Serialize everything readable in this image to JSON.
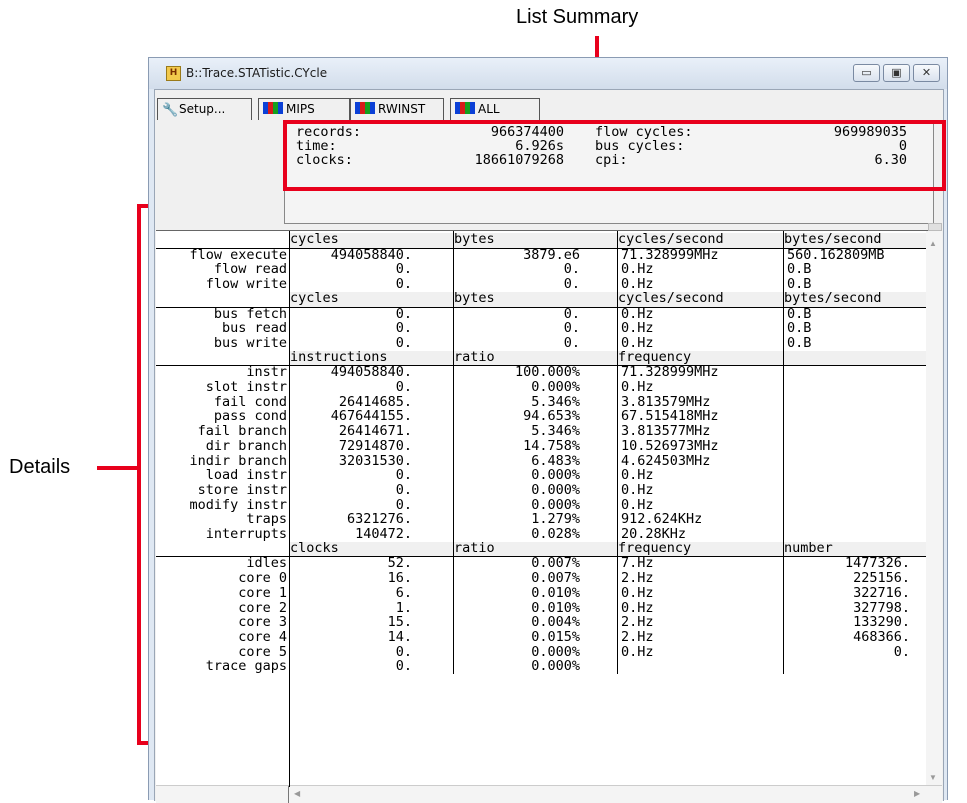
{
  "annotations": {
    "list_summary_label": "List Summary",
    "details_label": "Details"
  },
  "window": {
    "title": "B::Trace.STATistic.CYcle",
    "icon_label": "H",
    "controls": {
      "minimize": "▭",
      "maximize": "▣",
      "close": "✕"
    }
  },
  "toolbar": {
    "setup_label": "Setup...",
    "mips_label": "MIPS",
    "rwinst_label": "RWINST",
    "all_label": "ALL"
  },
  "summary": {
    "records_label": "records:",
    "records_value": "966374400",
    "time_label": "time:",
    "time_value": "6.926s",
    "clocks_label": "clocks:",
    "clocks_value": "18661079268",
    "flow_cycles_label": "flow cycles:",
    "flow_cycles_value": "969989035",
    "bus_cycles_label": "bus cycles:",
    "bus_cycles_value": "0",
    "cpi_label": "cpi:",
    "cpi_value": "6.30"
  },
  "sections": [
    {
      "headers": [
        "cycles",
        "bytes",
        "cycles/second",
        "bytes/second"
      ],
      "rows": [
        {
          "label": "flow execute",
          "c1": "494058840.",
          "c2": "3879.e6",
          "c3": "71.328999MHz",
          "c4": "560.162809MB"
        },
        {
          "label": "flow read",
          "c1": "0.",
          "c2": "0.",
          "c3": "0.Hz",
          "c4": "0.B"
        },
        {
          "label": "flow write",
          "c1": "0.",
          "c2": "0.",
          "c3": "0.Hz",
          "c4": "0.B"
        }
      ]
    },
    {
      "headers": [
        "cycles",
        "bytes",
        "cycles/second",
        "bytes/second"
      ],
      "rows": [
        {
          "label": "bus fetch",
          "c1": "0.",
          "c2": "0.",
          "c3": "0.Hz",
          "c4": "0.B"
        },
        {
          "label": "bus read",
          "c1": "0.",
          "c2": "0.",
          "c3": "0.Hz",
          "c4": "0.B"
        },
        {
          "label": "bus write",
          "c1": "0.",
          "c2": "0.",
          "c3": "0.Hz",
          "c4": "0.B"
        }
      ]
    },
    {
      "headers": [
        "instructions",
        "ratio",
        "frequency",
        ""
      ],
      "rows": [
        {
          "label": "instr",
          "c1": "494058840.",
          "c2": "100.000%",
          "c3": "71.328999MHz",
          "c4": ""
        },
        {
          "label": "slot instr",
          "c1": "0.",
          "c2": "0.000%",
          "c3": "0.Hz",
          "c4": ""
        },
        {
          "label": "fail cond",
          "c1": "26414685.",
          "c2": "5.346%",
          "c3": "3.813579MHz",
          "c4": ""
        },
        {
          "label": "pass cond",
          "c1": "467644155.",
          "c2": "94.653%",
          "c3": "67.515418MHz",
          "c4": ""
        },
        {
          "label": "fail branch",
          "c1": "26414671.",
          "c2": "5.346%",
          "c3": "3.813577MHz",
          "c4": ""
        },
        {
          "label": "dir branch",
          "c1": "72914870.",
          "c2": "14.758%",
          "c3": "10.526973MHz",
          "c4": ""
        },
        {
          "label": "indir branch",
          "c1": "32031530.",
          "c2": "6.483%",
          "c3": "4.624503MHz",
          "c4": ""
        },
        {
          "label": "load instr",
          "c1": "0.",
          "c2": "0.000%",
          "c3": "0.Hz",
          "c4": ""
        },
        {
          "label": "store instr",
          "c1": "0.",
          "c2": "0.000%",
          "c3": "0.Hz",
          "c4": ""
        },
        {
          "label": "modify instr",
          "c1": "0.",
          "c2": "0.000%",
          "c3": "0.Hz",
          "c4": ""
        },
        {
          "label": "traps",
          "c1": "6321276.",
          "c2": "1.279%",
          "c3": "912.624KHz",
          "c4": ""
        },
        {
          "label": "interrupts",
          "c1": "140472.",
          "c2": "0.028%",
          "c3": "20.28KHz",
          "c4": ""
        }
      ]
    },
    {
      "headers": [
        "clocks",
        "ratio",
        "frequency",
        "number"
      ],
      "rows": [
        {
          "label": "idles",
          "c1": "52.",
          "c2": "0.007%",
          "c3": "7.Hz",
          "c4": "1477326."
        },
        {
          "label": "core 0",
          "c1": "16.",
          "c2": "0.007%",
          "c3": "2.Hz",
          "c4": "225156."
        },
        {
          "label": "core 1",
          "c1": "6.",
          "c2": "0.010%",
          "c3": "0.Hz",
          "c4": "322716."
        },
        {
          "label": "core 2",
          "c1": "1.",
          "c2": "0.010%",
          "c3": "0.Hz",
          "c4": "327798."
        },
        {
          "label": "core 3",
          "c1": "15.",
          "c2": "0.004%",
          "c3": "2.Hz",
          "c4": "133290."
        },
        {
          "label": "core 4",
          "c1": "14.",
          "c2": "0.015%",
          "c3": "2.Hz",
          "c4": "468366."
        },
        {
          "label": "core 5",
          "c1": "0.",
          "c2": "0.000%",
          "c3": "0.Hz",
          "c4": "0."
        },
        {
          "label": "trace gaps",
          "c1": "0.",
          "c2": "0.000%",
          "c3": "",
          "c4": ""
        }
      ]
    }
  ],
  "scrollbar": {
    "up": "▲",
    "down": "▼",
    "left": "◀",
    "right": "▶"
  }
}
